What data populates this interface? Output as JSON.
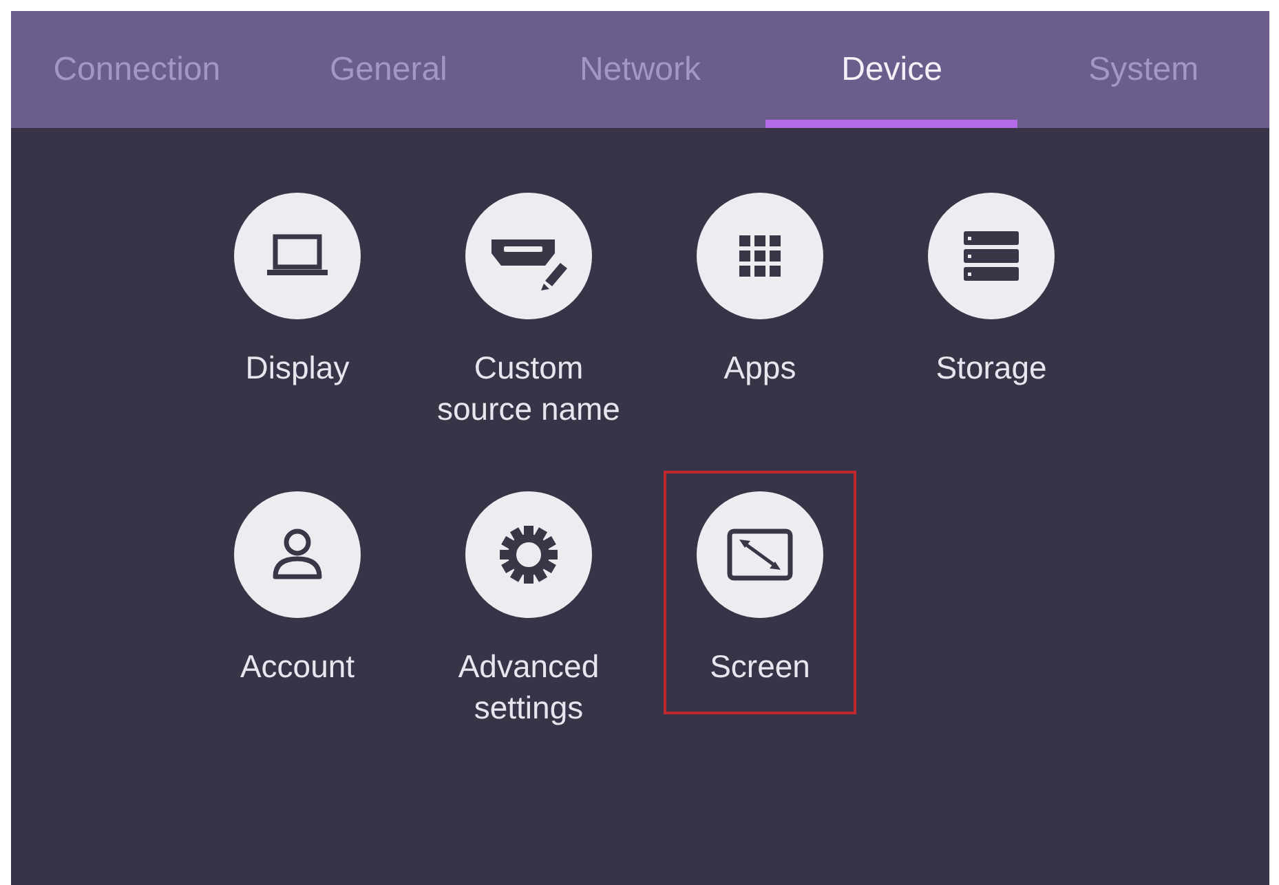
{
  "tabs": [
    {
      "label": "Connection",
      "selected": false
    },
    {
      "label": "General",
      "selected": false
    },
    {
      "label": "Network",
      "selected": false
    },
    {
      "label": "Device",
      "selected": true
    },
    {
      "label": "System",
      "selected": false
    }
  ],
  "items": [
    {
      "kind": "laptop",
      "label": "Display",
      "highlighted": false
    },
    {
      "kind": "port",
      "label": "Custom source name",
      "highlighted": false
    },
    {
      "kind": "grid",
      "label": "Apps",
      "highlighted": false
    },
    {
      "kind": "drives",
      "label": "Storage",
      "highlighted": false
    },
    {
      "kind": "person",
      "label": "Account",
      "highlighted": false
    },
    {
      "kind": "gear",
      "label": "Advanced settings",
      "highlighted": false
    },
    {
      "kind": "resize",
      "label": "Screen",
      "highlighted": true
    }
  ]
}
